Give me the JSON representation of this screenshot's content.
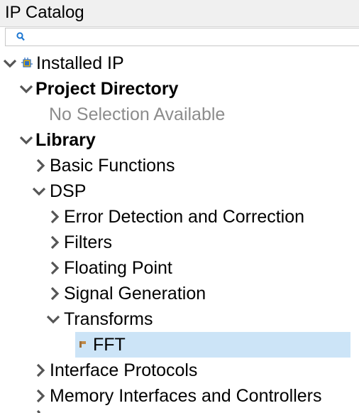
{
  "panel": {
    "title": "IP Catalog",
    "search": {
      "value": "",
      "placeholder": ""
    }
  },
  "tree": [
    {
      "id": "installed-ip",
      "label": "Installed IP",
      "expanded": true,
      "icon": "installed-ip-icon"
    },
    {
      "id": "project-directory",
      "label": "Project Directory",
      "expanded": true,
      "bold": true
    },
    {
      "id": "no-selection",
      "label": "No Selection Available",
      "muted": true
    },
    {
      "id": "library",
      "label": "Library",
      "expanded": true,
      "bold": true
    },
    {
      "id": "basic-functions",
      "label": "Basic Functions",
      "expanded": false
    },
    {
      "id": "dsp",
      "label": "DSP",
      "expanded": true
    },
    {
      "id": "error-detection",
      "label": "Error Detection and Correction",
      "expanded": false
    },
    {
      "id": "filters",
      "label": "Filters",
      "expanded": false
    },
    {
      "id": "floating-point",
      "label": "Floating Point",
      "expanded": false
    },
    {
      "id": "signal-generation",
      "label": "Signal Generation",
      "expanded": false
    },
    {
      "id": "transforms",
      "label": "Transforms",
      "expanded": true
    },
    {
      "id": "fft",
      "label": "FFT",
      "selected": true,
      "icon": "ip-core-icon"
    },
    {
      "id": "interface-protocols",
      "label": "Interface Protocols",
      "expanded": false
    },
    {
      "id": "memory-interfaces",
      "label": "Memory Interfaces and Controllers",
      "expanded": false
    }
  ],
  "colors": {
    "selection": "#cce4f7",
    "muted_text": "#8c8c8c",
    "chevron": "#555555",
    "search_icon": "#1e78d2"
  }
}
